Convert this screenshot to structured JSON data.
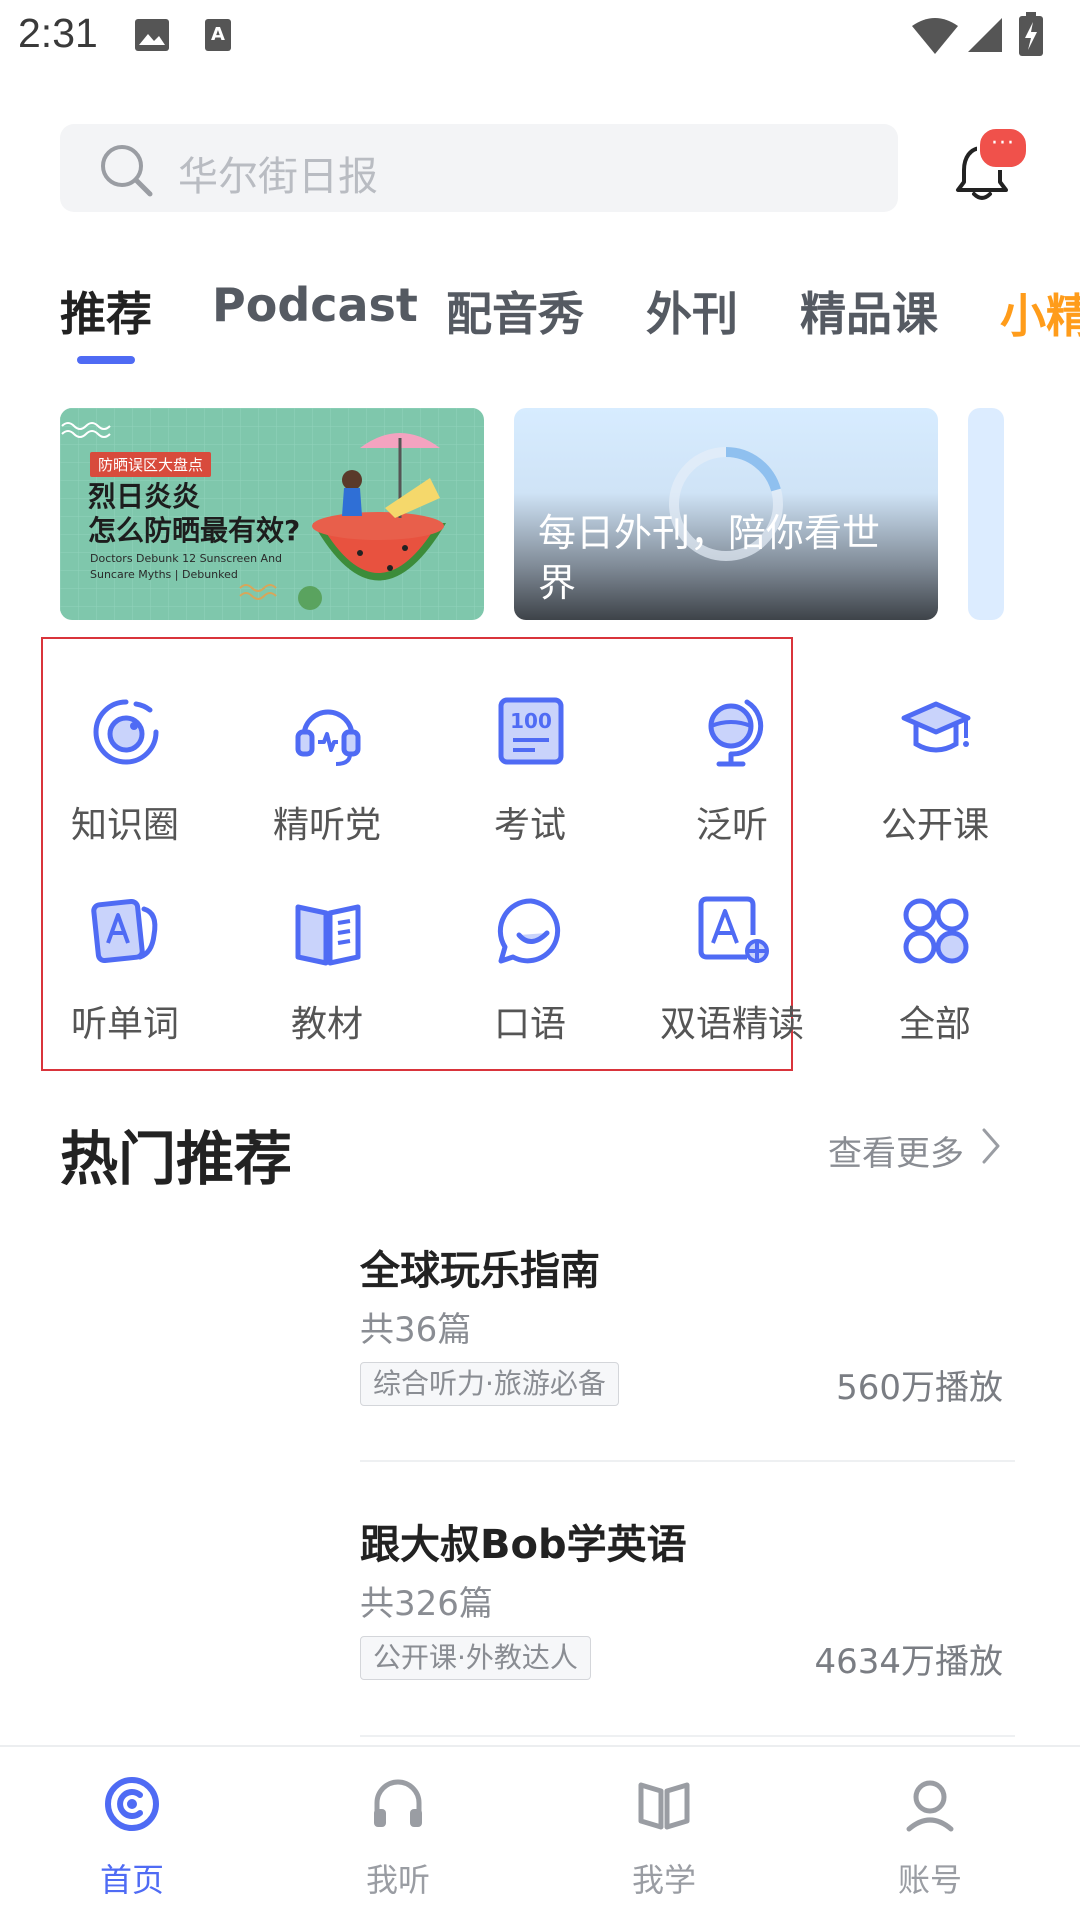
{
  "status_bar": {
    "time": "2:31"
  },
  "search": {
    "placeholder": "华尔街日报"
  },
  "notification": {
    "badge": "···"
  },
  "tabs": [
    {
      "label": "推荐",
      "active": true
    },
    {
      "label": "Podcast"
    },
    {
      "label": "配音秀"
    },
    {
      "label": "外刊"
    },
    {
      "label": "精品课"
    },
    {
      "label": "小精"
    }
  ],
  "banners": [
    {
      "tag": "防晒误区大盘点",
      "headline_line1": "烈日炎炎",
      "headline_line2": "怎么防晒最有效?",
      "subtitle": "Doctors Debunk 12 Sunscreen And Suncare Myths | Debunked"
    },
    {
      "caption": "每日外刊，陪你看世界"
    }
  ],
  "grid": [
    {
      "label": "知识圈",
      "icon": "knowledge-circle-icon"
    },
    {
      "label": "精听党",
      "icon": "headset-icon"
    },
    {
      "label": "考试",
      "icon": "exam-score-icon"
    },
    {
      "label": "泛听",
      "icon": "globe-icon"
    },
    {
      "label": "公开课",
      "icon": "graduation-cap-icon"
    },
    {
      "label": "听单词",
      "icon": "word-card-icon"
    },
    {
      "label": "教材",
      "icon": "book-icon"
    },
    {
      "label": "口语",
      "icon": "speech-bubble-icon"
    },
    {
      "label": "双语精读",
      "icon": "bilingual-read-icon"
    },
    {
      "label": "全部",
      "icon": "all-grid-icon"
    }
  ],
  "hot": {
    "title": "热门推荐",
    "see_more": "查看更多",
    "items": [
      {
        "title": "全球玩乐指南",
        "count": "共36篇",
        "tag": "综合听力·旅游必备",
        "plays": "560万播放"
      },
      {
        "title": "跟大叔Bob学英语",
        "count": "共326篇",
        "tag": "公开课·外教达人",
        "plays": "4634万播放"
      }
    ]
  },
  "bottom_nav": [
    {
      "label": "首页",
      "active": true
    },
    {
      "label": "我听"
    },
    {
      "label": "我学"
    },
    {
      "label": "账号"
    }
  ],
  "colors": {
    "accent": "#4f6bf4",
    "badge": "#f0514b",
    "highlight_box": "#d9343b",
    "tab_fade": "#ff9c1a"
  }
}
